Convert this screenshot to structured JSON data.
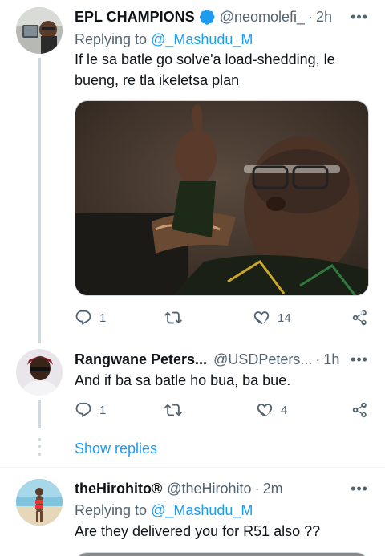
{
  "tweets": [
    {
      "name": "EPL CHAMPIONS",
      "verified": true,
      "handle": "@neomolefi_",
      "time": "2h",
      "replying_prefix": "Replying to",
      "replying_to": "@_Mashudu_M",
      "text": "If le sa batle go solve'a load-shedding, le bueng, re tla ikeletsa plan",
      "media": "photo",
      "replies": "1",
      "retweets": "",
      "likes": "14"
    },
    {
      "name": "Rangwane Peters...",
      "handle": "@USDPeters...",
      "time": "1h",
      "text": "And if ba sa batle ho bua, ba bue.",
      "replies": "1",
      "retweets": "",
      "likes": "4"
    },
    {
      "name": "theHirohito®",
      "handle": "@theHirohito",
      "time": "2m",
      "replying_prefix": "Replying to",
      "replying_to": "@_Mashudu_M",
      "text": "Are they delivered you for R51 also ??"
    }
  ],
  "show_replies": "Show replies",
  "colors": {
    "accent": "#1d9bf0",
    "secondary_text": "#536471",
    "thread_line": "#cfd9de"
  },
  "icons": [
    "reply-icon",
    "retweet-icon",
    "like-icon",
    "share-icon",
    "more-icon",
    "verified-badge-icon"
  ]
}
